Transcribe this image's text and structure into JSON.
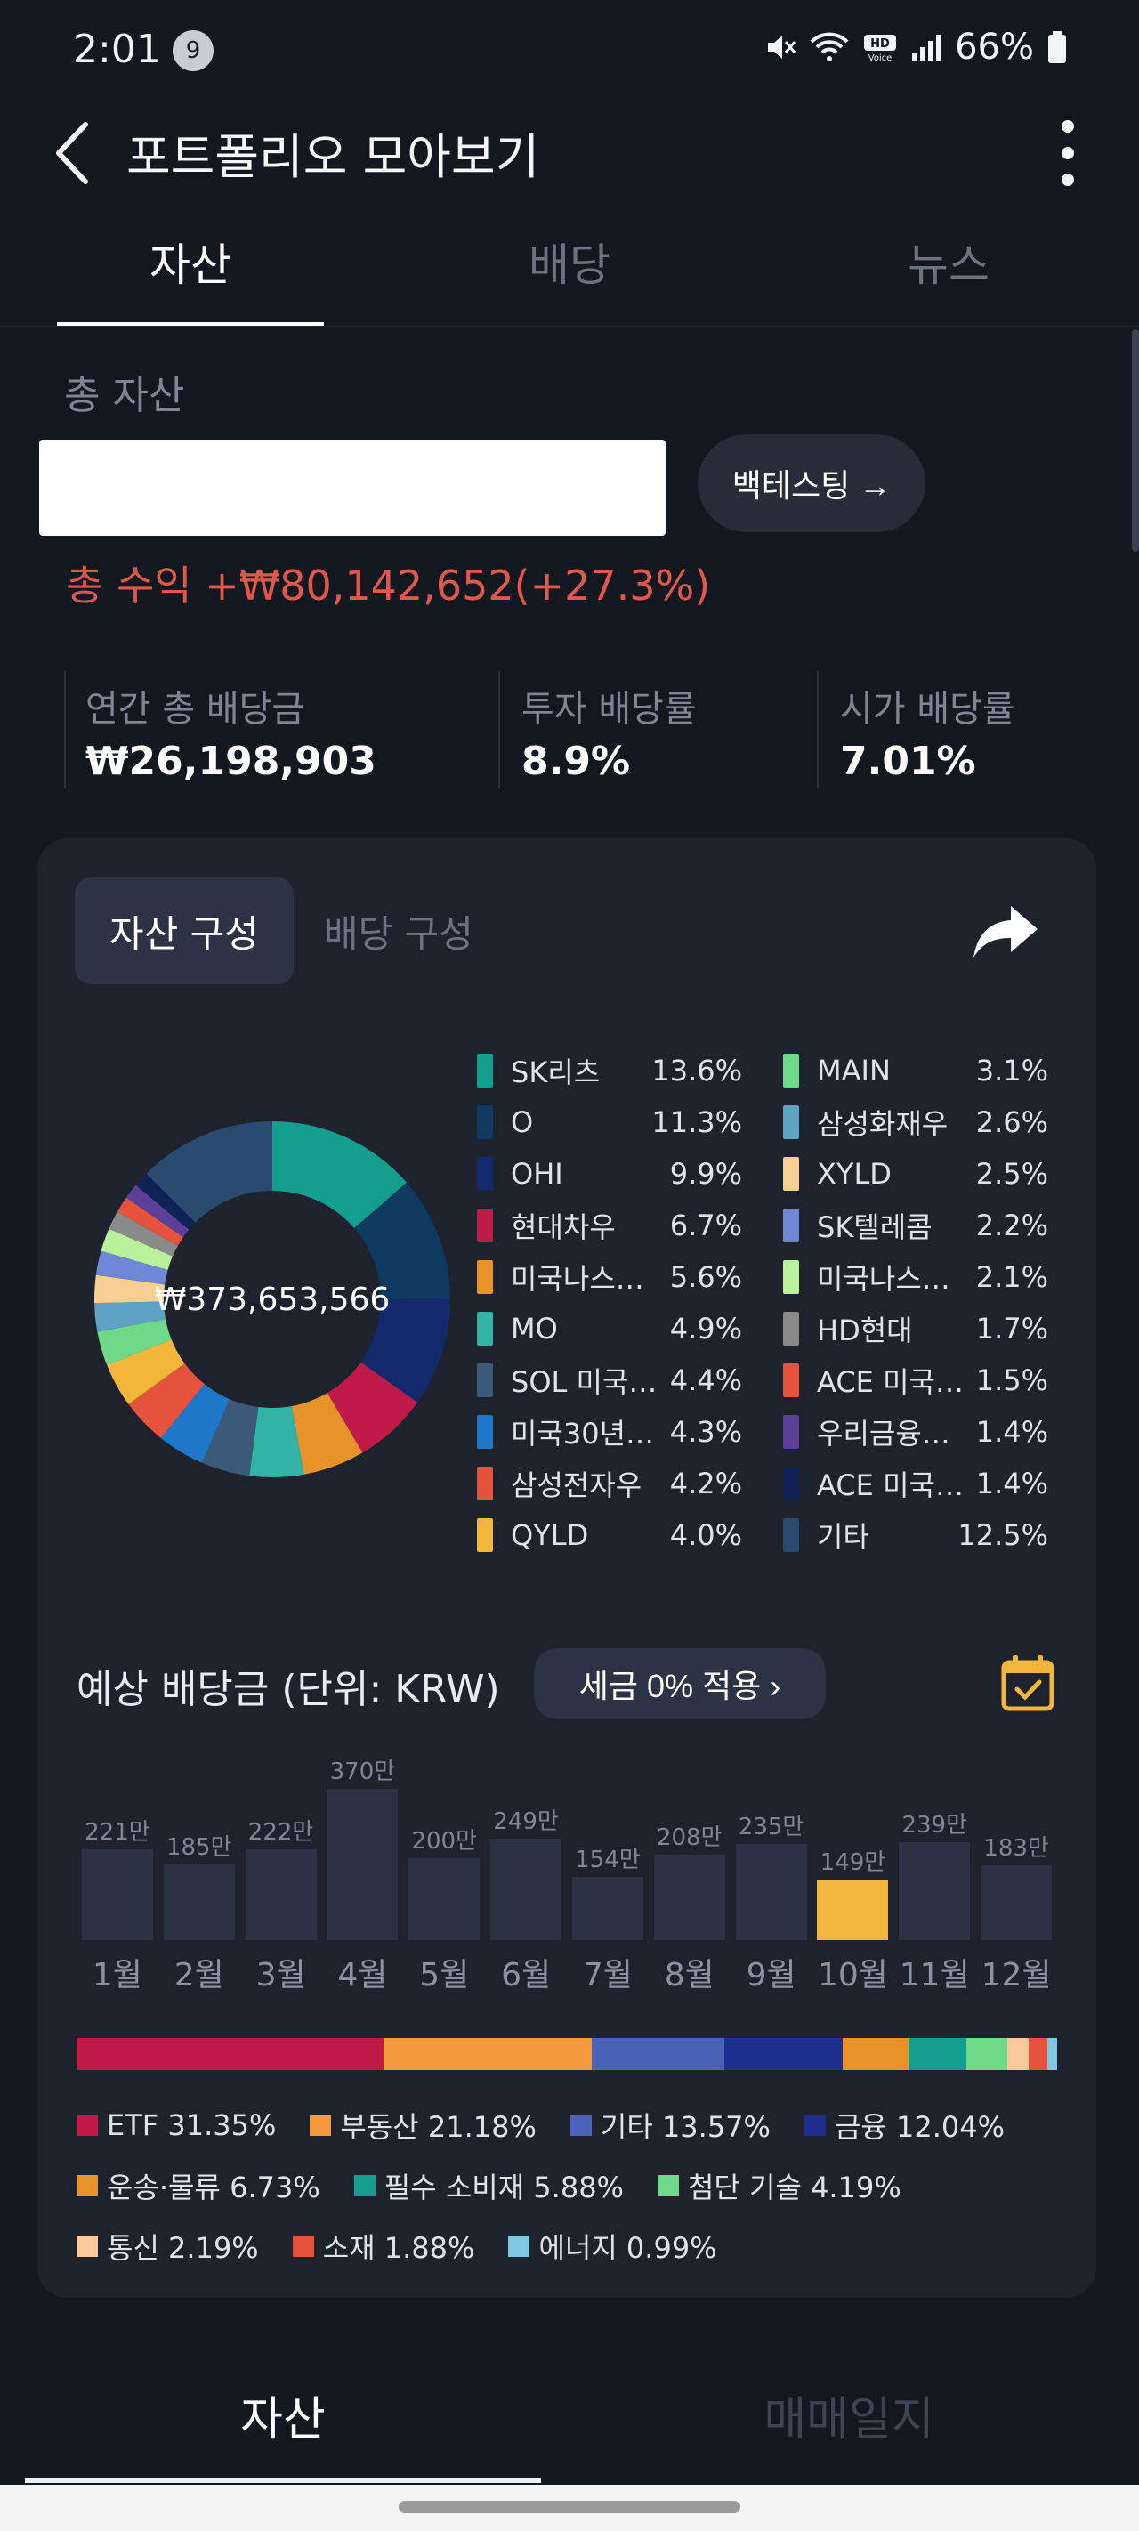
{
  "status": {
    "time": "2:01",
    "notif_count": "9",
    "battery": "66%"
  },
  "header": {
    "title": "포트폴리오 모아보기"
  },
  "tabs": [
    "자산",
    "배당",
    "뉴스"
  ],
  "summary": {
    "total_label": "총 자산",
    "backtest_label": "백테스팅 →",
    "profit_text": "총 수익 +₩80,142,652(+27.3%)"
  },
  "stats": [
    {
      "label": "연간 총 배당금",
      "value": "₩26,198,903"
    },
    {
      "label": "투자 배당률",
      "value": "8.9%"
    },
    {
      "label": "시가 배당률",
      "value": "7.01%"
    }
  ],
  "composition": {
    "seg_active": "자산 구성",
    "seg_inactive": "배당 구성",
    "center_value": "₩373,653,566",
    "items": [
      {
        "name": "SK리츠",
        "pct": "13.6%",
        "value": 13.6,
        "color": "#149e8e"
      },
      {
        "name": "O",
        "pct": "11.3%",
        "value": 11.3,
        "color": "#0d3a5e"
      },
      {
        "name": "OHI",
        "pct": "9.9%",
        "value": 9.9,
        "color": "#122a6b"
      },
      {
        "name": "현대차우",
        "pct": "6.7%",
        "value": 6.7,
        "color": "#c01a48"
      },
      {
        "name": "미국나스…",
        "pct": "5.6%",
        "value": 5.6,
        "color": "#e8922a"
      },
      {
        "name": "MO",
        "pct": "4.9%",
        "value": 4.9,
        "color": "#33b3a6"
      },
      {
        "name": "SOL 미국…",
        "pct": "4.4%",
        "value": 4.4,
        "color": "#3b5a7a"
      },
      {
        "name": "미국30년…",
        "pct": "4.3%",
        "value": 4.3,
        "color": "#1f77c8"
      },
      {
        "name": "삼성전자우",
        "pct": "4.2%",
        "value": 4.2,
        "color": "#e5533d"
      },
      {
        "name": "QYLD",
        "pct": "4.0%",
        "value": 4.0,
        "color": "#f2b73a"
      },
      {
        "name": "MAIN",
        "pct": "3.1%",
        "value": 3.1,
        "color": "#6fd98a"
      },
      {
        "name": "삼성화재우",
        "pct": "2.6%",
        "value": 2.6,
        "color": "#5fa3c4"
      },
      {
        "name": "XYLD",
        "pct": "2.5%",
        "value": 2.5,
        "color": "#f8cf92"
      },
      {
        "name": "SK텔레콤",
        "pct": "2.2%",
        "value": 2.2,
        "color": "#6f88d6"
      },
      {
        "name": "미국나스…",
        "pct": "2.1%",
        "value": 2.1,
        "color": "#b9f19c"
      },
      {
        "name": "HD현대",
        "pct": "1.7%",
        "value": 1.7,
        "color": "#8a8a8a"
      },
      {
        "name": "ACE 미국…",
        "pct": "1.5%",
        "value": 1.5,
        "color": "#e5533d"
      },
      {
        "name": "우리금융…",
        "pct": "1.4%",
        "value": 1.4,
        "color": "#5b3f99"
      },
      {
        "name": "ACE 미국…",
        "pct": "1.4%",
        "value": 1.4,
        "color": "#0f2356"
      },
      {
        "name": "기타",
        "pct": "12.5%",
        "value": 12.5,
        "color": "#2a4a70"
      }
    ]
  },
  "dividends": {
    "title": "예상 배당금 (단위: KRW)",
    "tax_label": "세금 0% 적용 ›",
    "months": [
      "1월",
      "2월",
      "3월",
      "4월",
      "5월",
      "6월",
      "7월",
      "8월",
      "9월",
      "10월",
      "11월",
      "12월"
    ],
    "labels": [
      "221만",
      "185만",
      "222만",
      "370만",
      "200만",
      "249만",
      "154만",
      "208만",
      "235만",
      "149만",
      "239만",
      "183만"
    ],
    "values": [
      221,
      185,
      222,
      370,
      200,
      249,
      154,
      208,
      235,
      149,
      239,
      183
    ],
    "highlight_index": 9,
    "highlight_color": "#f1b63b"
  },
  "sectors": [
    {
      "name": "ETF 31.35%",
      "value": 31.35,
      "color": "#c01a48"
    },
    {
      "name": "부동산 21.18%",
      "value": 21.18,
      "color": "#f39a3d"
    },
    {
      "name": "기타 13.57%",
      "value": 13.57,
      "color": "#4a62b8"
    },
    {
      "name": "금융 12.04%",
      "value": 12.04,
      "color": "#1d2f8f"
    },
    {
      "name": "운송·물류 6.73%",
      "value": 6.73,
      "color": "#e8922a"
    },
    {
      "name": "필수 소비재 5.88%",
      "value": 5.88,
      "color": "#149e8e"
    },
    {
      "name": "첨단 기술 4.19%",
      "value": 4.19,
      "color": "#6fd98a"
    },
    {
      "name": "통신 2.19%",
      "value": 2.19,
      "color": "#f8c99a"
    },
    {
      "name": "소재 1.88%",
      "value": 1.88,
      "color": "#e5533d"
    },
    {
      "name": "에너지 0.99%",
      "value": 0.99,
      "color": "#7ec8e3"
    }
  ],
  "bottom_tabs": [
    "자산",
    "매매일지"
  ]
}
